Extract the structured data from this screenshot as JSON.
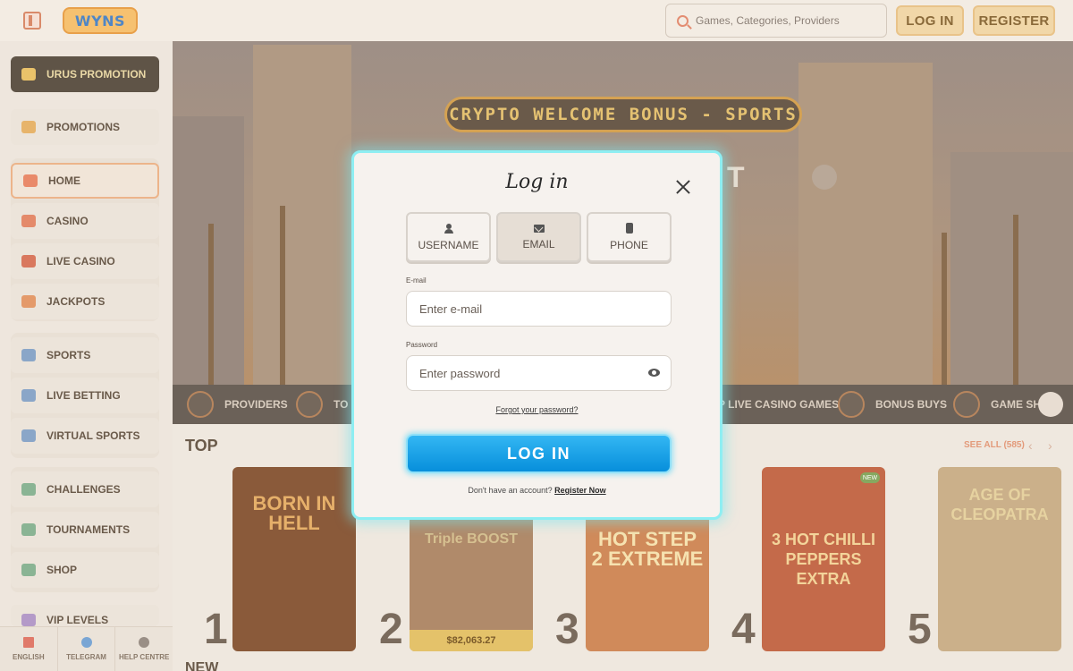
{
  "header": {
    "logo_text": "WYNS",
    "search_placeholder": "Games, Categories, Providers",
    "login_label": "LOG IN",
    "register_label": "REGISTER"
  },
  "sidebar": {
    "promo_label": "URUS PROMOTION",
    "items": [
      {
        "label": "PROMOTIONS"
      },
      {
        "label": "HOME"
      },
      {
        "label": "CASINO"
      },
      {
        "label": "LIVE CASINO"
      },
      {
        "label": "JACKPOTS"
      },
      {
        "label": "SPORTS"
      },
      {
        "label": "LIVE BETTING"
      },
      {
        "label": "VIRTUAL SPORTS"
      },
      {
        "label": "CHALLENGES"
      },
      {
        "label": "TOURNAMENTS"
      },
      {
        "label": "SHOP"
      },
      {
        "label": "VIP LEVELS"
      }
    ],
    "bottom": [
      {
        "label": "ENGLISH"
      },
      {
        "label": "TELEGRAM"
      },
      {
        "label": "HELP CENTRE"
      }
    ]
  },
  "banner": {
    "sign_text": "CRYPTO WELCOME BONUS - SPORTS",
    "partial_text": "T"
  },
  "categories": [
    {
      "label": "PROVIDERS"
    },
    {
      "label": "TO"
    },
    {
      "label": "P LIVE CASINO GAMES"
    },
    {
      "label": "BONUS BUYS"
    },
    {
      "label": "GAME SHO"
    }
  ],
  "games_section": {
    "title": "TOP",
    "see_all": "SEE ALL (585)",
    "games": [
      {
        "rank": "1",
        "title": "BORN IN HELL",
        "caption": ""
      },
      {
        "rank": "2",
        "title": "Triple BOOST",
        "caption": "$82,063.27"
      },
      {
        "rank": "3",
        "title": "HOT STEP 2 EXTREME",
        "caption": ""
      },
      {
        "rank": "4",
        "title": "3 HOT CHILLI PEPPERS EXTRA",
        "caption": "",
        "badge": "NEW"
      },
      {
        "rank": "5",
        "title": "AGE OF CLEOPATRA",
        "caption": ""
      }
    ],
    "next_title": "NEW"
  },
  "modal": {
    "title": "Log in",
    "tabs": [
      {
        "label": "USERNAME",
        "icon": "user-icon"
      },
      {
        "label": "EMAIL",
        "icon": "envelope-icon"
      },
      {
        "label": "PHONE",
        "icon": "phone-icon"
      }
    ],
    "email_label": "E-mail",
    "email_placeholder": "Enter e-mail",
    "password_label": "Password",
    "password_placeholder": "Enter password",
    "forgot_label": "Forgot your password?",
    "submit_label": "LOG IN",
    "no_account_text": "Don't have an account?",
    "register_link": "Register Now"
  },
  "colors": {
    "accent": "#0d95de",
    "modal_glow": "#8eeef2",
    "register_button": "#f1d7a8"
  }
}
